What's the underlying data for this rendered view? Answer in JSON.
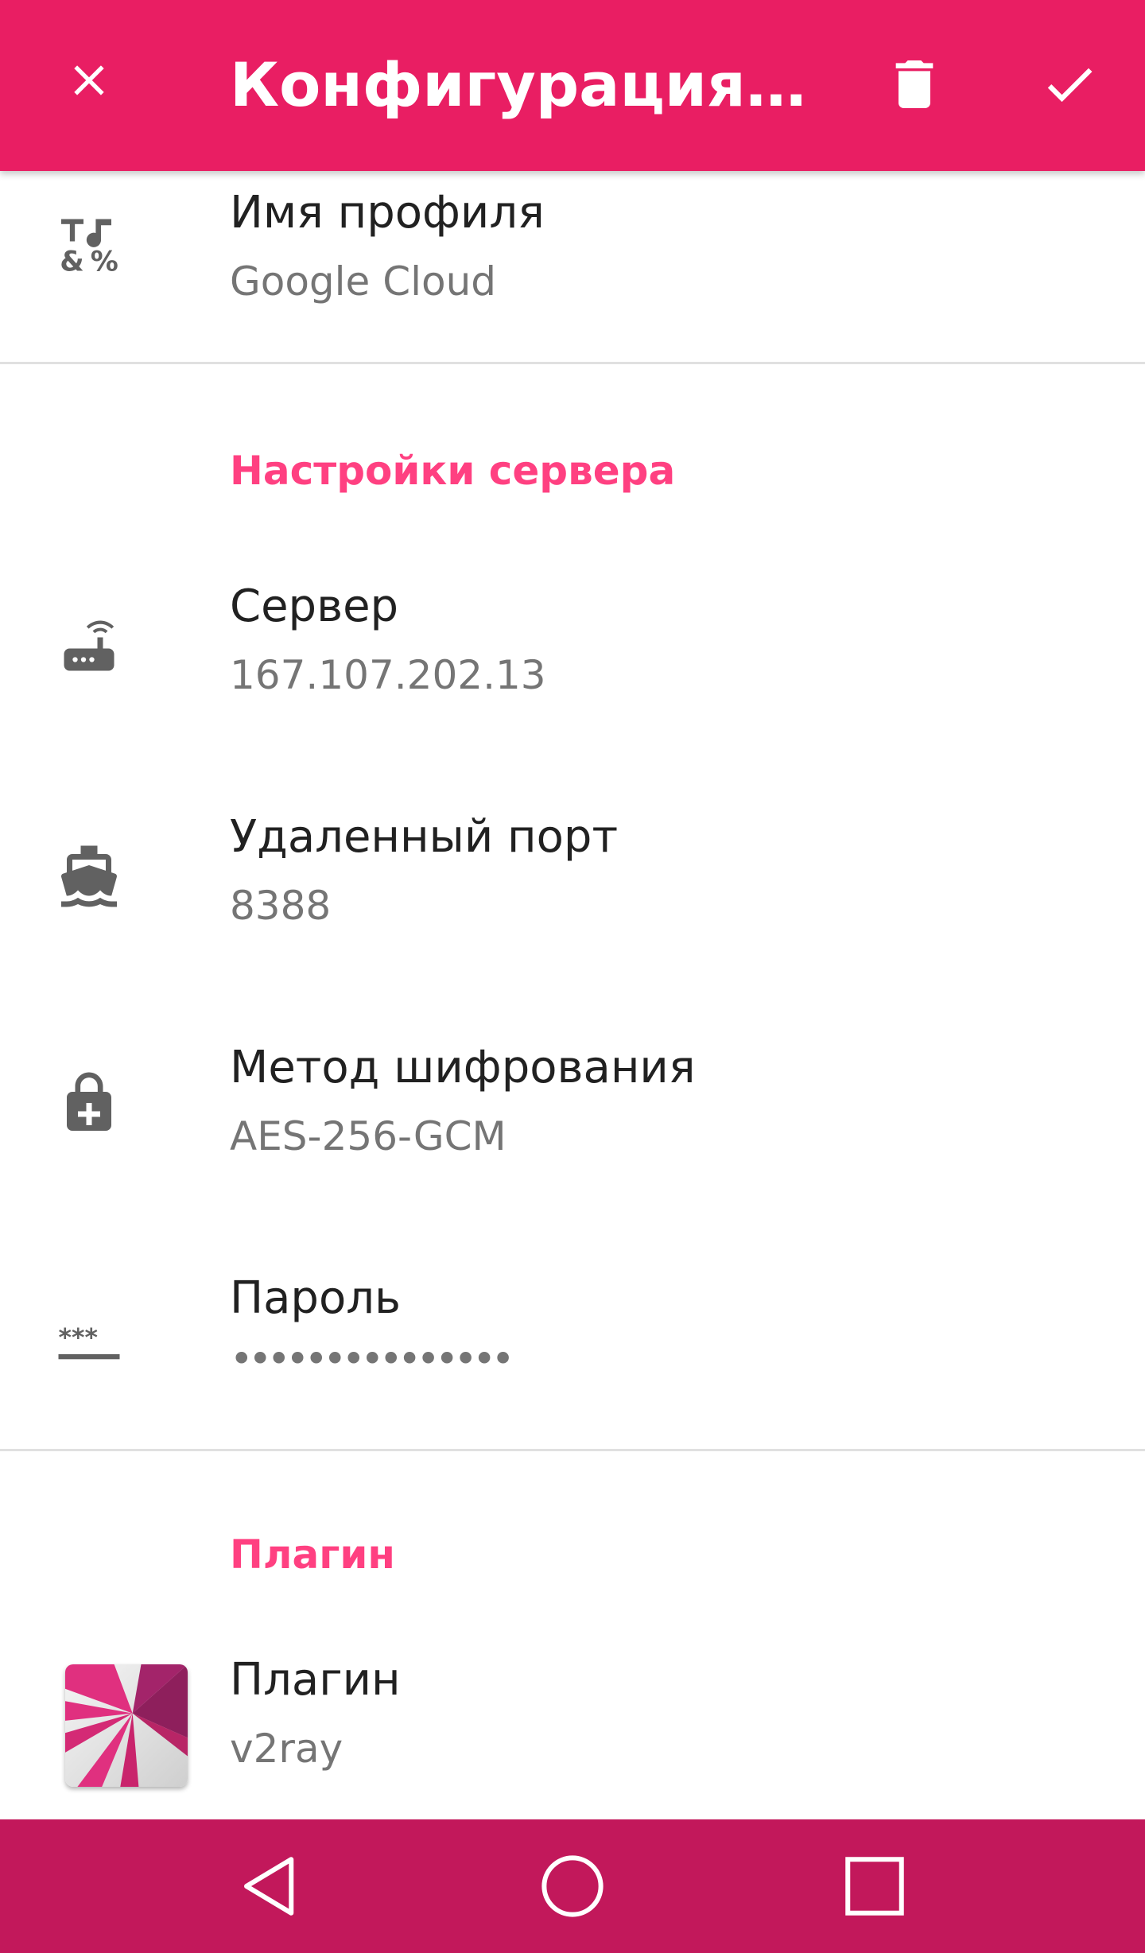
{
  "appbar": {
    "title": "Конфигурация пр...",
    "close_icon": "close-icon",
    "delete_icon": "trash-icon",
    "confirm_icon": "check-icon",
    "background": "#e91e63"
  },
  "profile": {
    "label": "Имя профиля",
    "value": "Google Cloud",
    "icon": "text-symbols-icon"
  },
  "server_section": {
    "header": "Настройки сервера",
    "items": [
      {
        "label": "Сервер",
        "value": "167.107.202.13",
        "icon": "router-icon"
      },
      {
        "label": "Удаленный порт",
        "value": "8388",
        "icon": "ship-icon"
      },
      {
        "label": "Метод шифрования",
        "value": "AES-256-GCM",
        "icon": "lock-plus-icon"
      },
      {
        "label": "Пароль",
        "value": "•••••••••••••••",
        "icon": "password-icon"
      }
    ]
  },
  "plugin_section": {
    "header": "Плагин",
    "item": {
      "label": "Плагин",
      "value": "v2ray",
      "icon": "v2ray-logo-icon"
    }
  },
  "navbar": {
    "back_icon": "back-triangle-icon",
    "home_icon": "home-circle-icon",
    "recents_icon": "recents-square-icon",
    "background": "#c2185b"
  },
  "colors": {
    "accent": "#ff4081",
    "primary": "#e91e63",
    "icon_gray": "#616161"
  }
}
